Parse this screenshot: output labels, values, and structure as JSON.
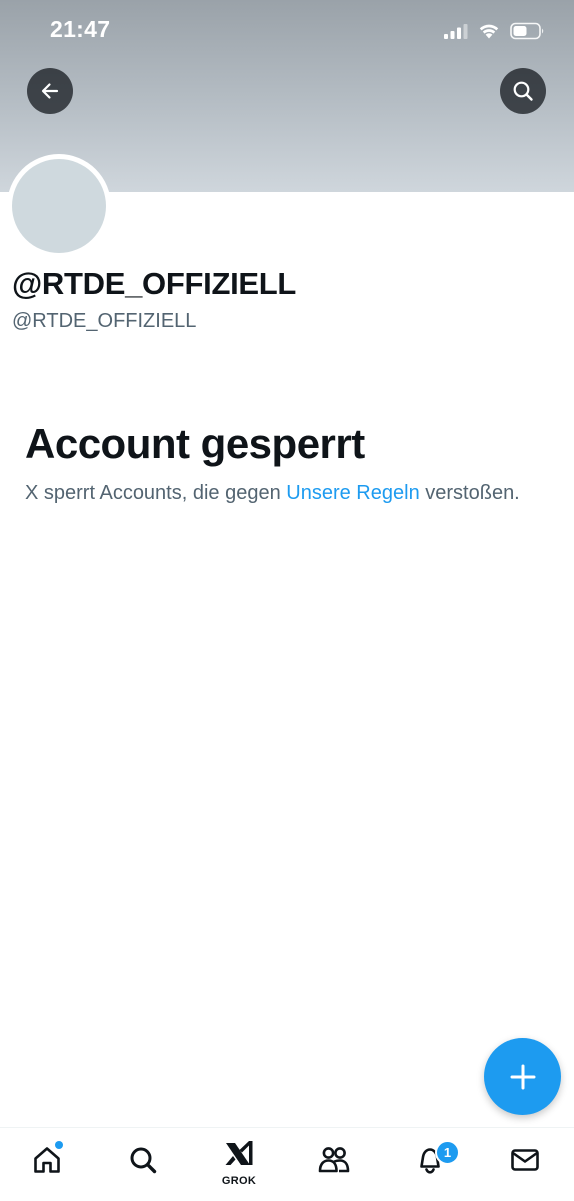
{
  "status_bar": {
    "time": "21:47"
  },
  "header": {
    "back_icon": "arrow-left-icon",
    "search_icon": "search-icon"
  },
  "profile": {
    "display_name": "@RTDE_OFFIZIELL",
    "handle": "@RTDE_OFFIZIELL"
  },
  "suspension": {
    "title": "Account gesperrt",
    "text_before": "X sperrt Accounts, die gegen ",
    "link": "Unsere Regeln",
    "text_after": " verstoßen."
  },
  "bottom_nav": {
    "items": [
      {
        "icon": "home-icon",
        "has_dot": true
      },
      {
        "icon": "search-icon"
      },
      {
        "icon": "grok-icon",
        "label": "GROK"
      },
      {
        "icon": "communities-icon"
      },
      {
        "icon": "bell-icon",
        "badge": "1"
      },
      {
        "icon": "mail-icon"
      }
    ]
  },
  "colors": {
    "accent": "#1d9bf0",
    "text_primary": "#0f1419",
    "text_secondary": "#536471",
    "banner": "#b6bec5",
    "avatar": "#cfd9de"
  }
}
